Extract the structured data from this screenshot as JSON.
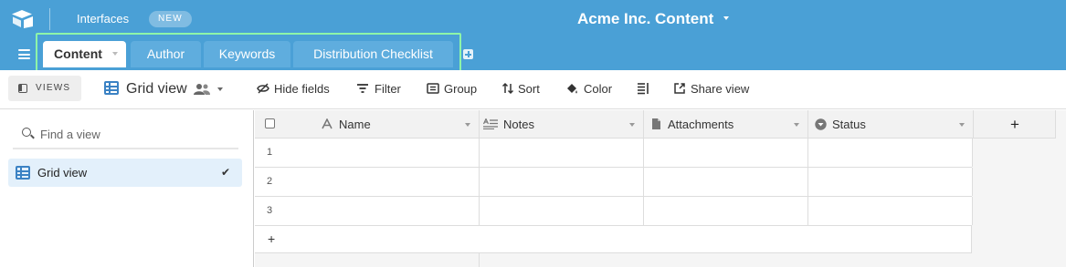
{
  "header": {
    "interfaces_label": "Interfaces",
    "new_badge": "NEW",
    "base_title": "Acme Inc. Content",
    "background_color": "#4aa0d6"
  },
  "tabs": [
    {
      "label": "Content",
      "active": true
    },
    {
      "label": "Author",
      "active": false
    },
    {
      "label": "Keywords",
      "active": false
    },
    {
      "label": "Distribution Checklist",
      "active": false
    }
  ],
  "toolbar": {
    "views_label": "VIEWS",
    "view_name": "Grid view",
    "hide_fields": "Hide fields",
    "filter": "Filter",
    "group": "Group",
    "sort": "Sort",
    "color": "Color",
    "share_view": "Share view"
  },
  "sidebar": {
    "search_placeholder": "Find a view",
    "views": [
      {
        "label": "Grid view",
        "selected": true
      }
    ]
  },
  "grid": {
    "columns": [
      {
        "label": "Name",
        "icon": "text-icon"
      },
      {
        "label": "Notes",
        "icon": "long-text-icon"
      },
      {
        "label": "Attachments",
        "icon": "attachment-icon"
      },
      {
        "label": "Status",
        "icon": "single-select-icon"
      }
    ],
    "rows": [
      "1",
      "2",
      "3"
    ],
    "add_column": "+",
    "add_row": "+"
  },
  "highlight_color": "#8ef5a8"
}
